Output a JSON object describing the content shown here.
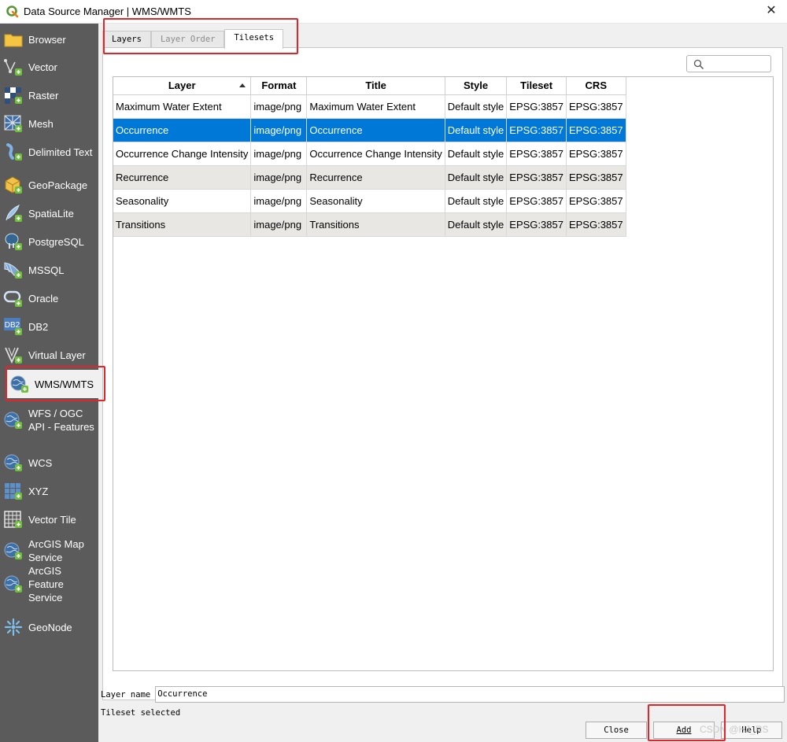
{
  "window": {
    "title": "Data Source Manager | WMS/WMTS",
    "close_glyph": "✕"
  },
  "sidebar": {
    "items": [
      {
        "label": "Browser",
        "icon": "folder-icon"
      },
      {
        "label": "Vector",
        "icon": "vector-icon"
      },
      {
        "label": "Raster",
        "icon": "raster-icon"
      },
      {
        "label": "Mesh",
        "icon": "mesh-icon"
      },
      {
        "label": "Delimited Text",
        "icon": "delimited-text-icon"
      },
      {
        "label": "GeoPackage",
        "icon": "geopackage-icon"
      },
      {
        "label": "SpatiaLite",
        "icon": "spatialite-icon"
      },
      {
        "label": "PostgreSQL",
        "icon": "postgresql-icon"
      },
      {
        "label": "MSSQL",
        "icon": "mssql-icon"
      },
      {
        "label": "Oracle",
        "icon": "oracle-icon"
      },
      {
        "label": "DB2",
        "icon": "db2-icon"
      },
      {
        "label": "Virtual Layer",
        "icon": "virtual-layer-icon"
      },
      {
        "label": "WMS/WMTS",
        "icon": "wms-globe-icon"
      },
      {
        "label_line1": "WFS / OGC",
        "label_line2": "API - Features",
        "icon": "wfs-globe-icon"
      },
      {
        "label": "WCS",
        "icon": "wcs-globe-icon"
      },
      {
        "label": "XYZ",
        "icon": "xyz-grid-icon"
      },
      {
        "label": "Vector Tile",
        "icon": "vector-tile-icon"
      },
      {
        "label_line1": "ArcGIS Map",
        "label_line2": "Service",
        "icon": "arcgis-map-icon"
      },
      {
        "label_line1": "ArcGIS Feature",
        "label_line2": "Service",
        "icon": "arcgis-feature-icon"
      },
      {
        "label": "GeoNode",
        "icon": "geonode-icon"
      }
    ],
    "db2_badge": "DB2"
  },
  "tabs": [
    {
      "label": "Layers"
    },
    {
      "label": "Layer Order"
    },
    {
      "label": "Tilesets"
    }
  ],
  "search": {
    "placeholder": "",
    "icon": "search-icon"
  },
  "table": {
    "columns": [
      "Layer",
      "Format",
      "Title",
      "Style",
      "Tileset",
      "CRS"
    ],
    "rows": [
      [
        "Maximum Water Extent",
        "image/png",
        "Maximum Water Extent",
        "Default style",
        "EPSG:3857",
        "EPSG:3857"
      ],
      [
        "Occurrence",
        "image/png",
        "Occurrence",
        "Default style",
        "EPSG:3857",
        "EPSG:3857"
      ],
      [
        "Occurrence Change Intensity",
        "image/png",
        "Occurrence Change Intensity",
        "Default style",
        "EPSG:3857",
        "EPSG:3857"
      ],
      [
        "Recurrence",
        "image/png",
        "Recurrence",
        "Default style",
        "EPSG:3857",
        "EPSG:3857"
      ],
      [
        "Seasonality",
        "image/png",
        "Seasonality",
        "Default style",
        "EPSG:3857",
        "EPSG:3857"
      ],
      [
        "Transitions",
        "image/png",
        "Transitions",
        "Default style",
        "EPSG:3857",
        "EPSG:3857"
      ]
    ],
    "selected_row": "Occurrence"
  },
  "layer_name": {
    "label": "Layer name",
    "value": "Occurrence"
  },
  "status": "Tileset selected",
  "buttons": {
    "close": "Close",
    "add": "Add",
    "help": "Help"
  },
  "watermark": "CSDN @HJ_RS",
  "colors": {
    "sidebar_bg": "#5b5b5b",
    "selection": "#0078d7",
    "highlight_box": "#e1252b"
  }
}
